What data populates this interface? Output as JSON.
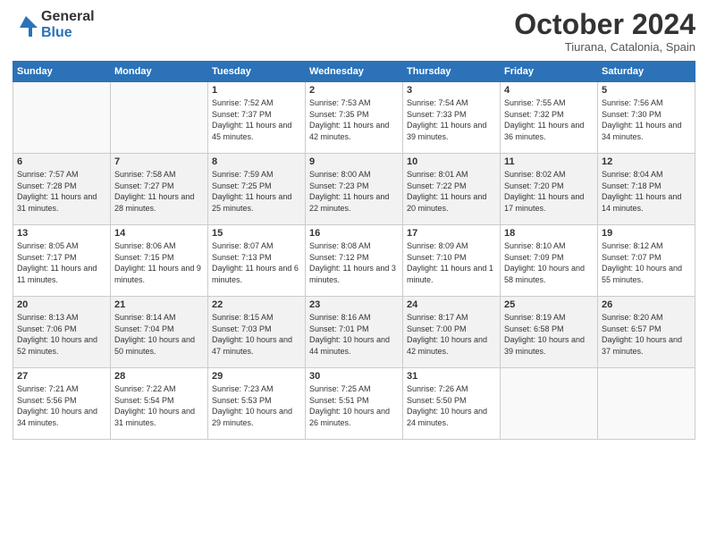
{
  "header": {
    "logo_general": "General",
    "logo_blue": "Blue",
    "month_title": "October 2024",
    "location": "Tiurana, Catalonia, Spain"
  },
  "days_of_week": [
    "Sunday",
    "Monday",
    "Tuesday",
    "Wednesday",
    "Thursday",
    "Friday",
    "Saturday"
  ],
  "weeks": [
    [
      {
        "day": "",
        "info": ""
      },
      {
        "day": "",
        "info": ""
      },
      {
        "day": "1",
        "info": "Sunrise: 7:52 AM\nSunset: 7:37 PM\nDaylight: 11 hours and 45 minutes."
      },
      {
        "day": "2",
        "info": "Sunrise: 7:53 AM\nSunset: 7:35 PM\nDaylight: 11 hours and 42 minutes."
      },
      {
        "day": "3",
        "info": "Sunrise: 7:54 AM\nSunset: 7:33 PM\nDaylight: 11 hours and 39 minutes."
      },
      {
        "day": "4",
        "info": "Sunrise: 7:55 AM\nSunset: 7:32 PM\nDaylight: 11 hours and 36 minutes."
      },
      {
        "day": "5",
        "info": "Sunrise: 7:56 AM\nSunset: 7:30 PM\nDaylight: 11 hours and 34 minutes."
      }
    ],
    [
      {
        "day": "6",
        "info": "Sunrise: 7:57 AM\nSunset: 7:28 PM\nDaylight: 11 hours and 31 minutes."
      },
      {
        "day": "7",
        "info": "Sunrise: 7:58 AM\nSunset: 7:27 PM\nDaylight: 11 hours and 28 minutes."
      },
      {
        "day": "8",
        "info": "Sunrise: 7:59 AM\nSunset: 7:25 PM\nDaylight: 11 hours and 25 minutes."
      },
      {
        "day": "9",
        "info": "Sunrise: 8:00 AM\nSunset: 7:23 PM\nDaylight: 11 hours and 22 minutes."
      },
      {
        "day": "10",
        "info": "Sunrise: 8:01 AM\nSunset: 7:22 PM\nDaylight: 11 hours and 20 minutes."
      },
      {
        "day": "11",
        "info": "Sunrise: 8:02 AM\nSunset: 7:20 PM\nDaylight: 11 hours and 17 minutes."
      },
      {
        "day": "12",
        "info": "Sunrise: 8:04 AM\nSunset: 7:18 PM\nDaylight: 11 hours and 14 minutes."
      }
    ],
    [
      {
        "day": "13",
        "info": "Sunrise: 8:05 AM\nSunset: 7:17 PM\nDaylight: 11 hours and 11 minutes."
      },
      {
        "day": "14",
        "info": "Sunrise: 8:06 AM\nSunset: 7:15 PM\nDaylight: 11 hours and 9 minutes."
      },
      {
        "day": "15",
        "info": "Sunrise: 8:07 AM\nSunset: 7:13 PM\nDaylight: 11 hours and 6 minutes."
      },
      {
        "day": "16",
        "info": "Sunrise: 8:08 AM\nSunset: 7:12 PM\nDaylight: 11 hours and 3 minutes."
      },
      {
        "day": "17",
        "info": "Sunrise: 8:09 AM\nSunset: 7:10 PM\nDaylight: 11 hours and 1 minute."
      },
      {
        "day": "18",
        "info": "Sunrise: 8:10 AM\nSunset: 7:09 PM\nDaylight: 10 hours and 58 minutes."
      },
      {
        "day": "19",
        "info": "Sunrise: 8:12 AM\nSunset: 7:07 PM\nDaylight: 10 hours and 55 minutes."
      }
    ],
    [
      {
        "day": "20",
        "info": "Sunrise: 8:13 AM\nSunset: 7:06 PM\nDaylight: 10 hours and 52 minutes."
      },
      {
        "day": "21",
        "info": "Sunrise: 8:14 AM\nSunset: 7:04 PM\nDaylight: 10 hours and 50 minutes."
      },
      {
        "day": "22",
        "info": "Sunrise: 8:15 AM\nSunset: 7:03 PM\nDaylight: 10 hours and 47 minutes."
      },
      {
        "day": "23",
        "info": "Sunrise: 8:16 AM\nSunset: 7:01 PM\nDaylight: 10 hours and 44 minutes."
      },
      {
        "day": "24",
        "info": "Sunrise: 8:17 AM\nSunset: 7:00 PM\nDaylight: 10 hours and 42 minutes."
      },
      {
        "day": "25",
        "info": "Sunrise: 8:19 AM\nSunset: 6:58 PM\nDaylight: 10 hours and 39 minutes."
      },
      {
        "day": "26",
        "info": "Sunrise: 8:20 AM\nSunset: 6:57 PM\nDaylight: 10 hours and 37 minutes."
      }
    ],
    [
      {
        "day": "27",
        "info": "Sunrise: 7:21 AM\nSunset: 5:56 PM\nDaylight: 10 hours and 34 minutes."
      },
      {
        "day": "28",
        "info": "Sunrise: 7:22 AM\nSunset: 5:54 PM\nDaylight: 10 hours and 31 minutes."
      },
      {
        "day": "29",
        "info": "Sunrise: 7:23 AM\nSunset: 5:53 PM\nDaylight: 10 hours and 29 minutes."
      },
      {
        "day": "30",
        "info": "Sunrise: 7:25 AM\nSunset: 5:51 PM\nDaylight: 10 hours and 26 minutes."
      },
      {
        "day": "31",
        "info": "Sunrise: 7:26 AM\nSunset: 5:50 PM\nDaylight: 10 hours and 24 minutes."
      },
      {
        "day": "",
        "info": ""
      },
      {
        "day": "",
        "info": ""
      }
    ]
  ]
}
